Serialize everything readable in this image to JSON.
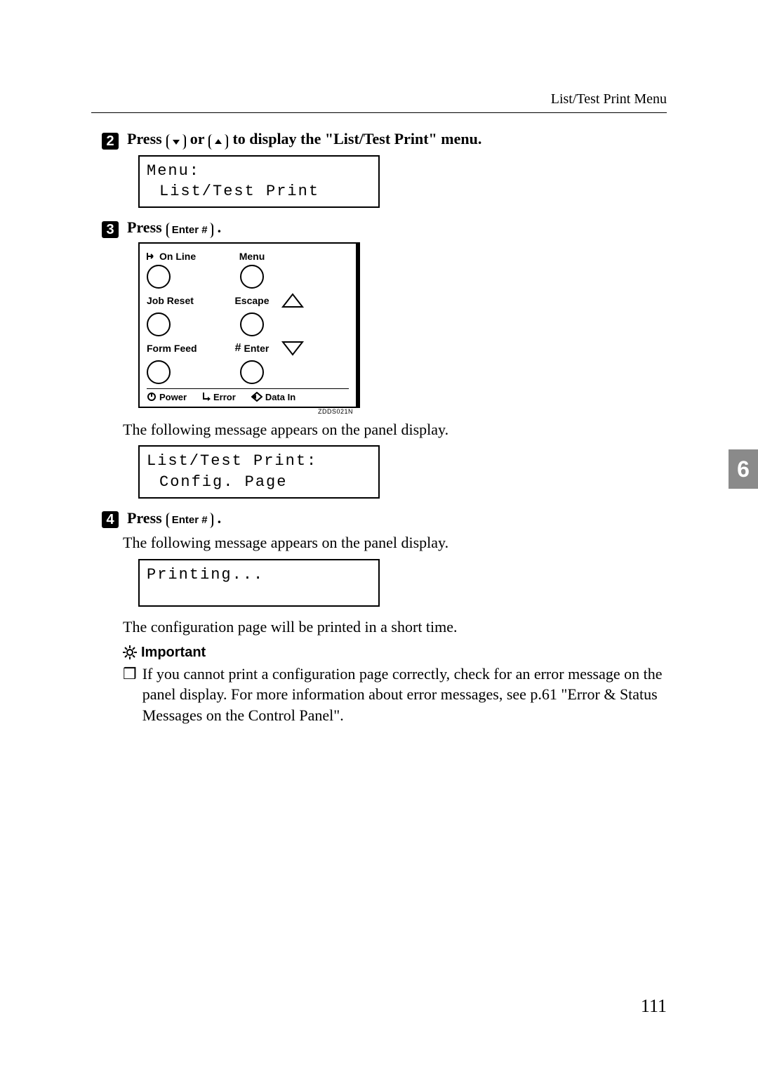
{
  "header": {
    "right_text": "List/Test Print Menu"
  },
  "side_tab": "6",
  "page_number": "111",
  "steps": {
    "s2": {
      "num": "2",
      "pre": "Press ",
      "mid": " or ",
      "post": " to display the \"List/Test Print\" menu."
    },
    "s3": {
      "num": "3",
      "pre": "Press ",
      "key_label": "Enter #",
      "post": "."
    },
    "s4": {
      "num": "4",
      "pre": "Press ",
      "key_label": "Enter #",
      "post": "."
    }
  },
  "lcd1": {
    "line1": "Menu:",
    "line2": "List/Test Print"
  },
  "lcd2": {
    "line1": "List/Test Print:",
    "line2": "Config. Page"
  },
  "lcd3": {
    "line1": "Printing...",
    "line2": ""
  },
  "panel": {
    "online": "On Line",
    "menu": "Menu",
    "jobreset": "Job Reset",
    "escape": "Escape",
    "formfeed": "Form Feed",
    "enter": "Enter",
    "power": "Power",
    "error": "Error",
    "datain": "Data In",
    "caption": "ZDDS021N"
  },
  "body": {
    "after_panel": "The following message appears on the panel display.",
    "after_step4": "The following message appears on the panel display.",
    "config_print": "The configuration page will be printed in a short time."
  },
  "important": {
    "heading": "Important",
    "note": "If you cannot print a configuration page correctly, check for an error message on the panel display. For more information about error messages, see p.61 \"Error & Status Messages on the Control Panel\"."
  }
}
